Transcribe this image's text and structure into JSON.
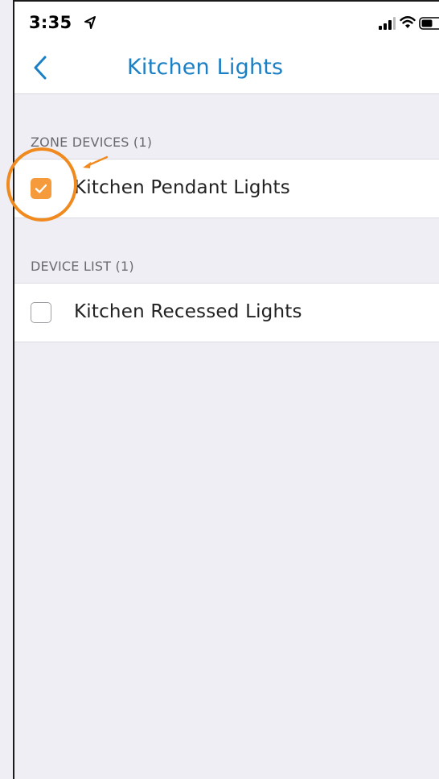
{
  "status_bar": {
    "time": "3:35",
    "location_icon": "location-arrow-icon",
    "signal_icon": "cellular-signal-icon",
    "wifi_icon": "wifi-icon",
    "battery_icon": "battery-icon"
  },
  "nav": {
    "back_icon": "chevron-left-icon",
    "title": "Kitchen Lights"
  },
  "zone_devices": {
    "header": "ZONE DEVICES (1)",
    "items": [
      {
        "label": "Kitchen Pendant Lights",
        "checked": true
      }
    ]
  },
  "device_list": {
    "header": "DEVICE LIST (1)",
    "items": [
      {
        "label": "Kitchen Recessed Lights",
        "checked": false
      }
    ]
  },
  "colors": {
    "accent": "#1b7fc4",
    "checkbox_checked": "#f59b3c",
    "annotation": "#f08a1e",
    "background": "#efeef4"
  }
}
